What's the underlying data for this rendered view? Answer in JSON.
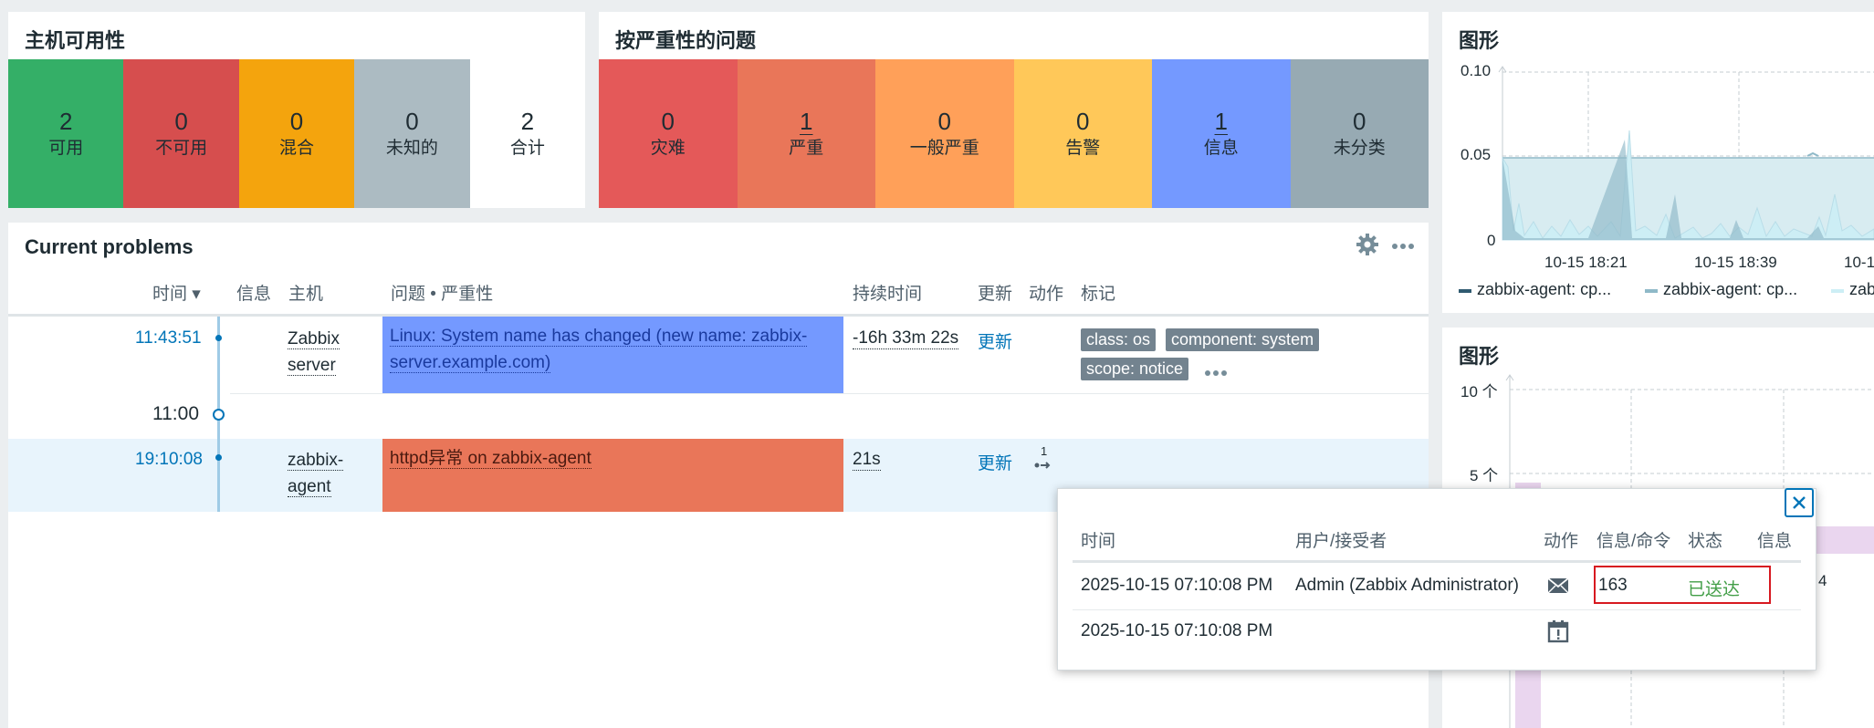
{
  "host_availability": {
    "title": "主机可用性",
    "tiles": [
      {
        "value": "2",
        "label": "可用",
        "color": "#34af67",
        "text": "#1f2c33"
      },
      {
        "value": "0",
        "label": "不可用",
        "color": "#d64e4e",
        "text": "#1f2c33"
      },
      {
        "value": "0",
        "label": "混合",
        "color": "#f4a40d",
        "text": "#1f2c33"
      },
      {
        "value": "0",
        "label": "未知的",
        "color": "#acbbc2",
        "text": "#1f2c33"
      },
      {
        "value": "2",
        "label": "合计",
        "color": "#ffffff",
        "text": "#1f2c33"
      }
    ]
  },
  "problems_by_severity": {
    "title": "按严重性的问题",
    "tiles": [
      {
        "value": "0",
        "label": "灾难",
        "color": "#e45959"
      },
      {
        "value": "1",
        "label": "严重",
        "color": "#e97659"
      },
      {
        "value": "0",
        "label": "一般严重",
        "color": "#ffa059"
      },
      {
        "value": "0",
        "label": "告警",
        "color": "#ffc859"
      },
      {
        "value": "1",
        "label": "信息",
        "color": "#7499ff"
      },
      {
        "value": "0",
        "label": "未分类",
        "color": "#97aab3"
      }
    ]
  },
  "current_problems": {
    "title": "Current problems",
    "headers": {
      "time": "时间 ▾",
      "info": "信息",
      "host": "主机",
      "problem": "问题 • 严重性",
      "duration": "持续时间",
      "update": "更新",
      "actions": "动作",
      "tags": "标记"
    },
    "rows": [
      {
        "time": "11:43:51",
        "host": "Zabbix server",
        "host_l1": "Zabbix",
        "host_l2": "server",
        "problem_l1": "Linux: System name has changed (new name: zabbix-",
        "problem_l2": "server.example.com)",
        "problem_color": "#7499ff",
        "duration": "-16h 33m 22s",
        "update": "更新",
        "tags": [
          "class: os",
          "component: system",
          "scope: notice"
        ]
      },
      {
        "time": "19:10:08",
        "host": "zabbix-agent",
        "host_l1": "zabbix-",
        "host_l2": "agent",
        "problem_l1": "httpd异常 on zabbix-agent",
        "problem_color": "#e97659",
        "duration": "21s",
        "update": "更新",
        "action_count": "1"
      }
    ],
    "timeline_marker": "11:00"
  },
  "graph1": {
    "title": "图形",
    "y_ticks": [
      "0.10",
      "0.05",
      "0"
    ],
    "x_ticks": [
      "10-15 18:21",
      "10-15 18:39",
      "10-1"
    ],
    "legend": [
      "zabbix-agent: cp...",
      "zabbix-agent: cp...",
      "zab"
    ],
    "legend_colors": [
      "#2f5a70",
      "#8fb9c8",
      "#cdeef5"
    ]
  },
  "graph2": {
    "title": "图形",
    "y_ticks": [
      "10 个",
      "5 个"
    ],
    "partial_label": "4"
  },
  "popup": {
    "headers": {
      "time": "时间",
      "user": "用户/接受者",
      "action": "动作",
      "message": "信息/命令",
      "status": "状态",
      "info": "信息"
    },
    "rows": [
      {
        "time": "2025-10-15 07:10:08 PM",
        "user": "Admin (Zabbix Administrator)",
        "icon": "envelope-icon",
        "message": "163",
        "status": "已送达",
        "status_color": "#429e47"
      },
      {
        "time": "2025-10-15 07:10:08 PM",
        "user": "",
        "icon": "calendar-icon",
        "message": "",
        "status": ""
      }
    ]
  }
}
